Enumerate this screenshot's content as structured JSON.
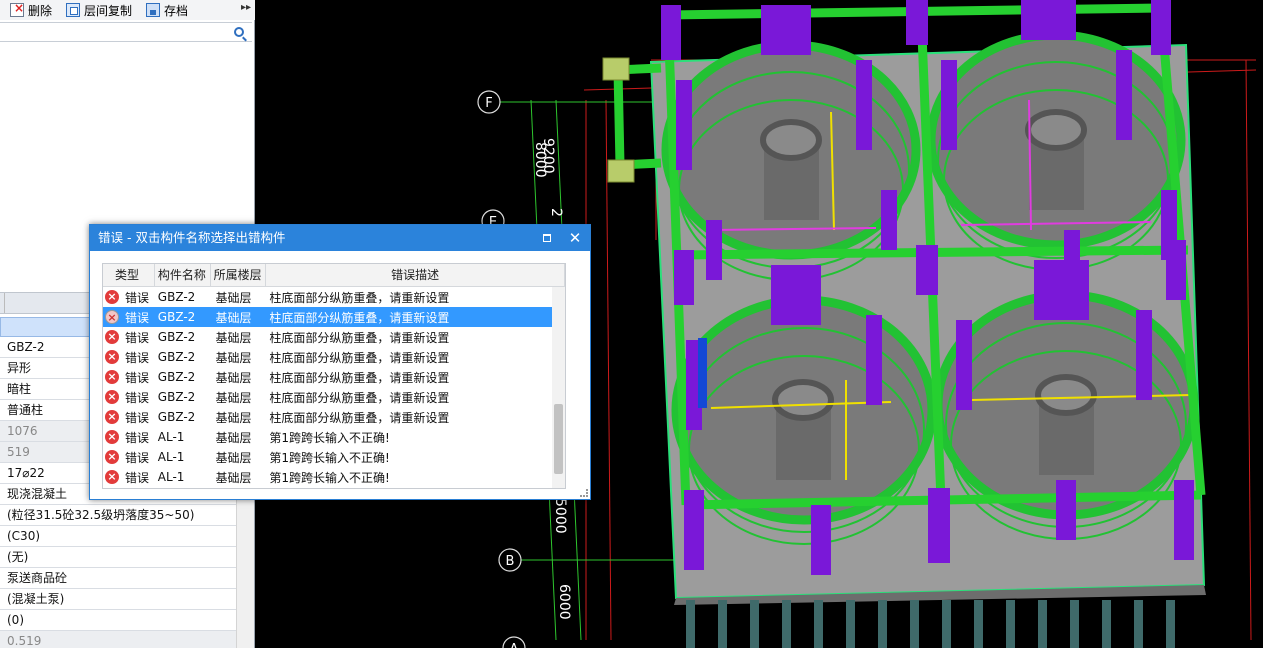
{
  "toolbar": {
    "delete_label": "删除",
    "copy_floor_label": "层间复制",
    "save_label": "存档",
    "more_glyph": "▸▸"
  },
  "properties": [
    {
      "value": "GBZ-2",
      "grey": false
    },
    {
      "value": "异形",
      "grey": false
    },
    {
      "value": "暗柱",
      "grey": false
    },
    {
      "value": "普通柱",
      "grey": false
    },
    {
      "value": "1076",
      "grey": true
    },
    {
      "value": "519",
      "grey": true
    },
    {
      "value": "17⌀22",
      "grey": false
    },
    {
      "value": "现浇混凝土",
      "grey": false
    },
    {
      "value": "(粒径31.5砼32.5级坍落度35~50)",
      "grey": false
    },
    {
      "value": "(C30)",
      "grey": false
    },
    {
      "value": "(无)",
      "grey": false
    },
    {
      "value": "泵送商品砼",
      "grey": false
    },
    {
      "value": "(混凝土泵)",
      "grey": false
    },
    {
      "value": "(0)",
      "grey": false
    },
    {
      "value": "0.519",
      "grey": true
    }
  ],
  "cad": {
    "axis_labels": [
      "F",
      "E",
      "B",
      "A"
    ],
    "dimensions": [
      "9200",
      "8000",
      "2",
      "5000",
      "6000"
    ]
  },
  "dialog": {
    "title": "错误 - 双击构件名称选择出错构件",
    "columns": [
      "类型",
      "构件名称",
      "所属楼层",
      "错误描述"
    ],
    "selected_index": 1,
    "rows": [
      {
        "type": "错误",
        "name": "GBZ-2",
        "floor": "基础层",
        "desc": "柱底面部分纵筋重叠，请重新设置"
      },
      {
        "type": "错误",
        "name": "GBZ-2",
        "floor": "基础层",
        "desc": "柱底面部分纵筋重叠，请重新设置"
      },
      {
        "type": "错误",
        "name": "GBZ-2",
        "floor": "基础层",
        "desc": "柱底面部分纵筋重叠，请重新设置"
      },
      {
        "type": "错误",
        "name": "GBZ-2",
        "floor": "基础层",
        "desc": "柱底面部分纵筋重叠，请重新设置"
      },
      {
        "type": "错误",
        "name": "GBZ-2",
        "floor": "基础层",
        "desc": "柱底面部分纵筋重叠，请重新设置"
      },
      {
        "type": "错误",
        "name": "GBZ-2",
        "floor": "基础层",
        "desc": "柱底面部分纵筋重叠，请重新设置"
      },
      {
        "type": "错误",
        "name": "GBZ-2",
        "floor": "基础层",
        "desc": "柱底面部分纵筋重叠，请重新设置"
      },
      {
        "type": "错误",
        "name": "AL-1",
        "floor": "基础层",
        "desc": "第1跨跨长输入不正确!"
      },
      {
        "type": "错误",
        "name": "AL-1",
        "floor": "基础层",
        "desc": "第1跨跨长输入不正确!"
      },
      {
        "type": "错误",
        "name": "AL-1",
        "floor": "基础层",
        "desc": "第1跨跨长输入不正确!"
      }
    ]
  }
}
